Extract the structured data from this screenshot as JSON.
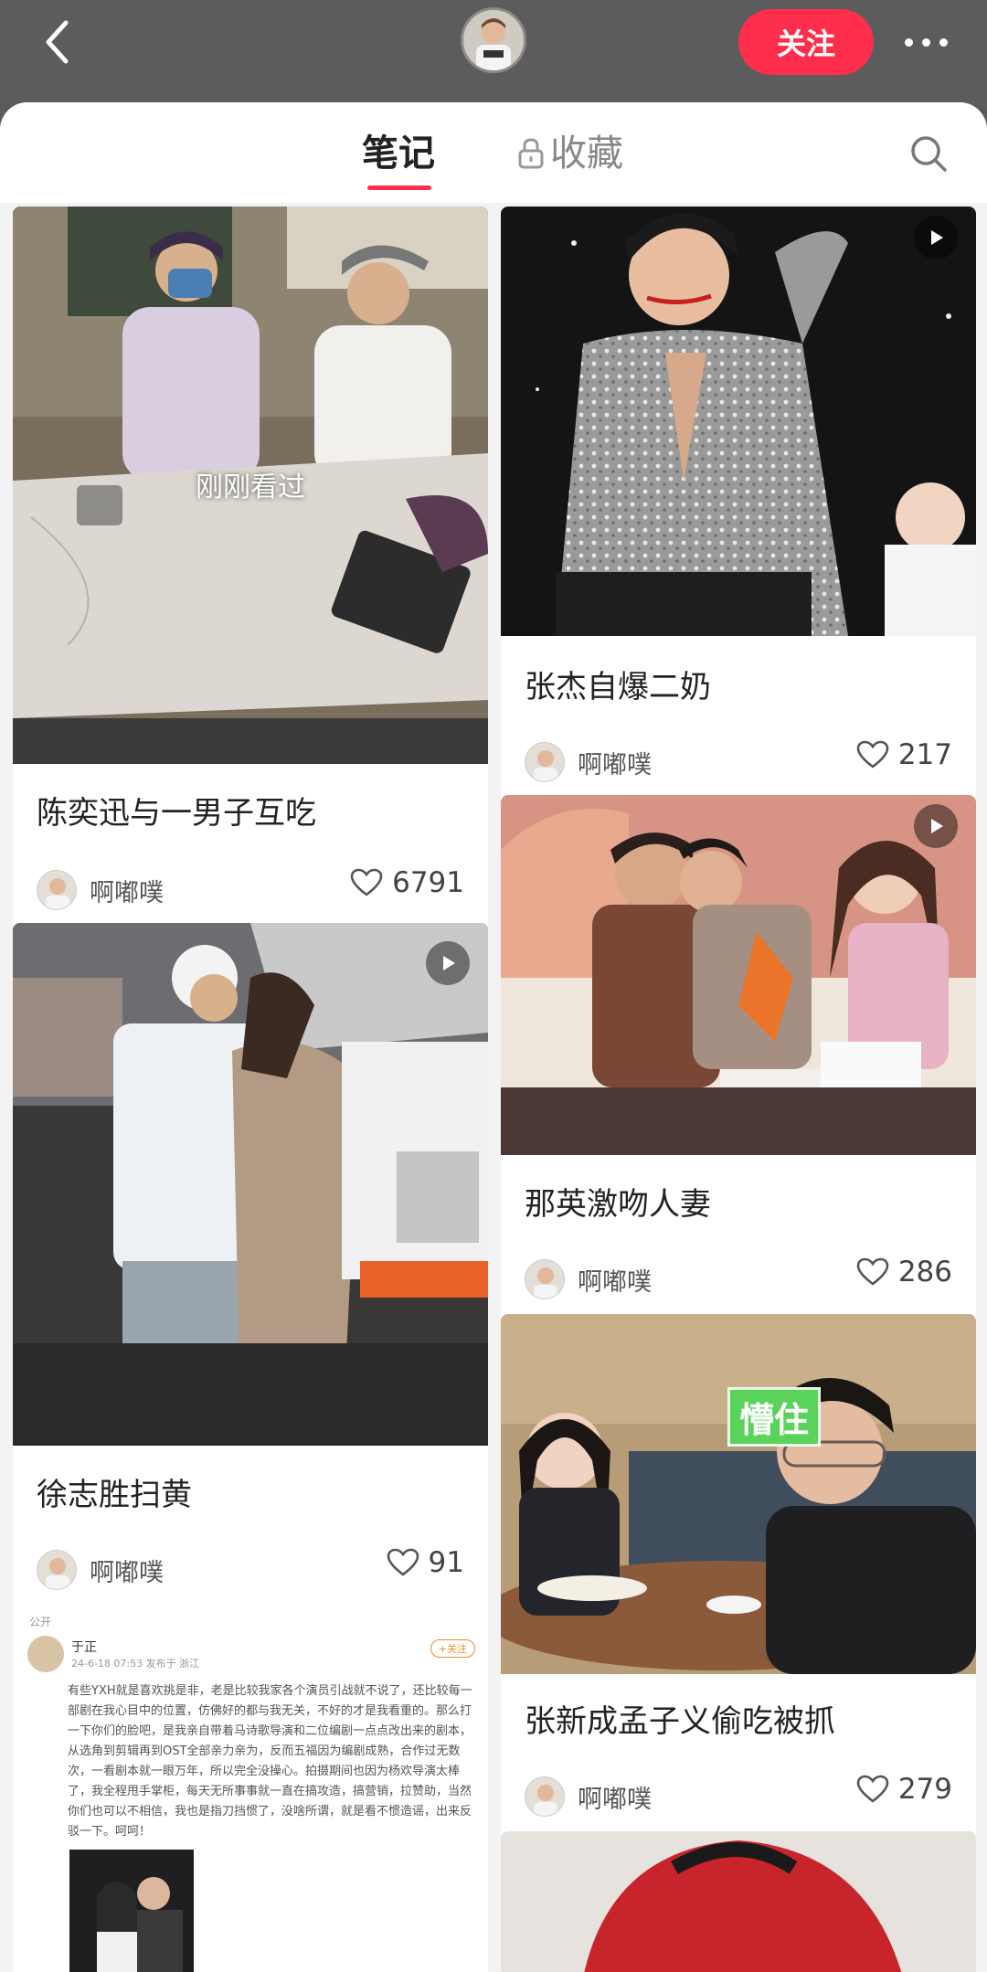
{
  "header": {
    "back_icon": "chevron-left-icon",
    "follow_label": "关注",
    "more_icon": "ellipsis-icon"
  },
  "tabs": {
    "notes": "笔记",
    "favorites": "收藏"
  },
  "notes": [
    {
      "title": "陈奕迅与一男子互吃",
      "author": "啊嘟噗",
      "likes": "6791",
      "overlay": "刚刚看过",
      "video": false
    },
    {
      "title": "张杰自爆二奶",
      "author": "啊嘟噗",
      "likes": "217",
      "video": true
    },
    {
      "title": "徐志胜扫黄",
      "author": "啊嘟噗",
      "likes": "91",
      "video": true
    },
    {
      "title": "那英激吻人妻",
      "author": "啊嘟噗",
      "likes": "286",
      "video": true
    },
    {
      "title": "张新成孟子义偷吃被抓",
      "author": "啊嘟噗",
      "likes": "279",
      "sticker": "懵住",
      "video": false
    }
  ],
  "embedded_post": {
    "scope": "公开",
    "user": "于正",
    "meta": "24-6-18 07:53 发布于 浙江",
    "follow": "+关注",
    "body": "有些YXH就是喜欢挑是非，老是比较我家各个演员引战就不说了，还比较每一部剧在我心目中的位置，仿佛好的都与我无关，不好的才是我看重的。那么打一下你们的脸吧，是我亲自带着马诗歌导演和二位编剧一点点改出来的剧本，从选角到剪辑再到OST全部亲力亲为，反而五福因为编剧成熟，合作过无数次，一看剧本就一眼万年，所以完全没操心。拍摄期间也因为杨欢导演太棒了，我全程甩手掌柜，每天无所事事就一直在搞攻造，搞营销，拉赞助，当然你们也可以不相信，我也是指刀挡惯了，没啥所谓，就是看不惯造谣，出来反驳一下。呵呵！"
  },
  "colors": {
    "accent": "#ff2e4d",
    "sticker": "#5ad35a"
  }
}
